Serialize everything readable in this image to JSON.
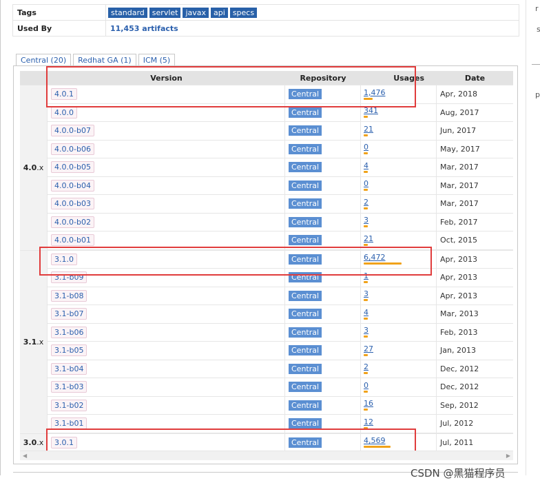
{
  "info": {
    "tags_label": "Tags",
    "tags": [
      "standard",
      "servlet",
      "javax",
      "api",
      "specs"
    ],
    "used_by_label": "Used By",
    "used_by_value": "11,453 artifacts"
  },
  "right_fragments": [
    "r",
    "s",
    "p"
  ],
  "tabs": [
    {
      "label": "Central (20)",
      "active": true
    },
    {
      "label": "Redhat GA (1)",
      "active": false
    },
    {
      "label": "ICM (5)",
      "active": false
    }
  ],
  "headers": {
    "version": "Version",
    "repository": "Repository",
    "usages": "Usages",
    "date": "Date"
  },
  "groups": [
    {
      "major": "4.0",
      "suffix": ".x",
      "rows": [
        {
          "version": "4.0.1",
          "repo": "Central",
          "usages": "1,476",
          "usage_fraction": 0.23,
          "date": "Apr, 2018"
        },
        {
          "version": "4.0.0",
          "repo": "Central",
          "usages": "341",
          "usage_fraction": 0.05,
          "date": "Aug, 2017"
        },
        {
          "version": "4.0.0-b07",
          "repo": "Central",
          "usages": "21",
          "usage_fraction": 0.01,
          "date": "Jun, 2017"
        },
        {
          "version": "4.0.0-b06",
          "repo": "Central",
          "usages": "0",
          "usage_fraction": 0.0,
          "date": "May, 2017"
        },
        {
          "version": "4.0.0-b05",
          "repo": "Central",
          "usages": "4",
          "usage_fraction": 0.0,
          "date": "Mar, 2017"
        },
        {
          "version": "4.0.0-b04",
          "repo": "Central",
          "usages": "0",
          "usage_fraction": 0.0,
          "date": "Mar, 2017"
        },
        {
          "version": "4.0.0-b03",
          "repo": "Central",
          "usages": "2",
          "usage_fraction": 0.0,
          "date": "Mar, 2017"
        },
        {
          "version": "4.0.0-b02",
          "repo": "Central",
          "usages": "3",
          "usage_fraction": 0.0,
          "date": "Feb, 2017"
        },
        {
          "version": "4.0.0-b01",
          "repo": "Central",
          "usages": "21",
          "usage_fraction": 0.01,
          "date": "Oct, 2015"
        }
      ]
    },
    {
      "major": "3.1",
      "suffix": ".x",
      "rows": [
        {
          "version": "3.1.0",
          "repo": "Central",
          "usages": "6,472",
          "usage_fraction": 1.0,
          "date": "Apr, 2013"
        },
        {
          "version": "3.1-b09",
          "repo": "Central",
          "usages": "1",
          "usage_fraction": 0.0,
          "date": "Apr, 2013"
        },
        {
          "version": "3.1-b08",
          "repo": "Central",
          "usages": "3",
          "usage_fraction": 0.0,
          "date": "Apr, 2013"
        },
        {
          "version": "3.1-b07",
          "repo": "Central",
          "usages": "4",
          "usage_fraction": 0.0,
          "date": "Mar, 2013"
        },
        {
          "version": "3.1-b06",
          "repo": "Central",
          "usages": "3",
          "usage_fraction": 0.0,
          "date": "Feb, 2013"
        },
        {
          "version": "3.1-b05",
          "repo": "Central",
          "usages": "27",
          "usage_fraction": 0.01,
          "date": "Jan, 2013"
        },
        {
          "version": "3.1-b04",
          "repo": "Central",
          "usages": "2",
          "usage_fraction": 0.0,
          "date": "Dec, 2012"
        },
        {
          "version": "3.1-b03",
          "repo": "Central",
          "usages": "0",
          "usage_fraction": 0.0,
          "date": "Dec, 2012"
        },
        {
          "version": "3.1-b02",
          "repo": "Central",
          "usages": "16",
          "usage_fraction": 0.01,
          "date": "Sep, 2012"
        },
        {
          "version": "3.1-b01",
          "repo": "Central",
          "usages": "12",
          "usage_fraction": 0.01,
          "date": "Jul, 2012"
        }
      ]
    },
    {
      "major": "3.0",
      "suffix": ".x",
      "rows": [
        {
          "version": "3.0.1",
          "repo": "Central",
          "usages": "4,569",
          "usage_fraction": 0.7,
          "date": "Jul, 2011"
        }
      ]
    }
  ],
  "highlight_color": "#e03b3b",
  "usage_bar_color": "#f0a21a",
  "tag_color": "#2860a8",
  "repo_badge_color": "#5b8fd2",
  "link_color": "#2a5fad",
  "watermark": "CSDN @黑猫程序员"
}
